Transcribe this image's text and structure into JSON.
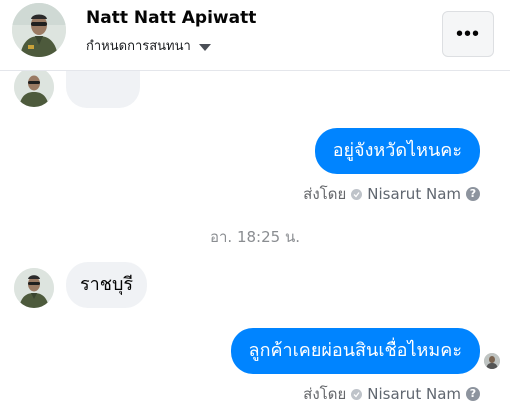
{
  "header": {
    "name": "Natt Natt Apiwatt",
    "subtitle": "กำหนดการสนทนา",
    "avatar_icon": "profile-photo",
    "more_icon": "more-horizontal-icon",
    "more_label": "•••"
  },
  "messages": [
    {
      "direction": "out",
      "text": "อยู่จังหวัดไหนคะ"
    },
    {
      "direction": "in",
      "text": "ราชบุรี"
    },
    {
      "direction": "out",
      "text": "ลูกค้าเคยผ่อนสินเชื่อไหมคะ"
    }
  ],
  "sent_by": {
    "label": "ส่งโดย",
    "sender": "Nisarut Nam",
    "help_glyph": "?"
  },
  "timestamp": "อา. 18:25 น.",
  "colors": {
    "outgoing_bubble": "#0084ff",
    "incoming_bubble": "#f0f2f5",
    "meta_text": "#65676b"
  }
}
